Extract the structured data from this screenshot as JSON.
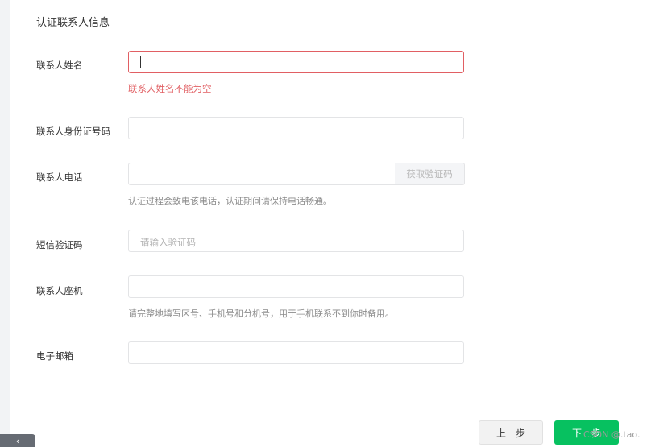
{
  "section_title": "认证联系人信息",
  "fields": {
    "contact_name": {
      "label": "联系人姓名",
      "error": "联系人姓名不能为空"
    },
    "contact_id": {
      "label": "联系人身份证号码"
    },
    "contact_phone": {
      "label": "联系人电话",
      "get_code_label": "获取验证码",
      "hint": "认证过程会致电该电话，认证期间请保持电话畅通。"
    },
    "sms_code": {
      "label": "短信验证码",
      "placeholder": "请输入验证码"
    },
    "landline": {
      "label": "联系人座机",
      "hint": "请完整地填写区号、手机号和分机号，用于手机联系不到你时备用。"
    },
    "email": {
      "label": "电子邮箱"
    }
  },
  "buttons": {
    "prev": "上一步",
    "next": "下一步"
  },
  "back_tab_icon": "‹",
  "watermark": "CSDN @.tao.",
  "colors": {
    "accent": "#07c160",
    "error": "#e15f63"
  }
}
